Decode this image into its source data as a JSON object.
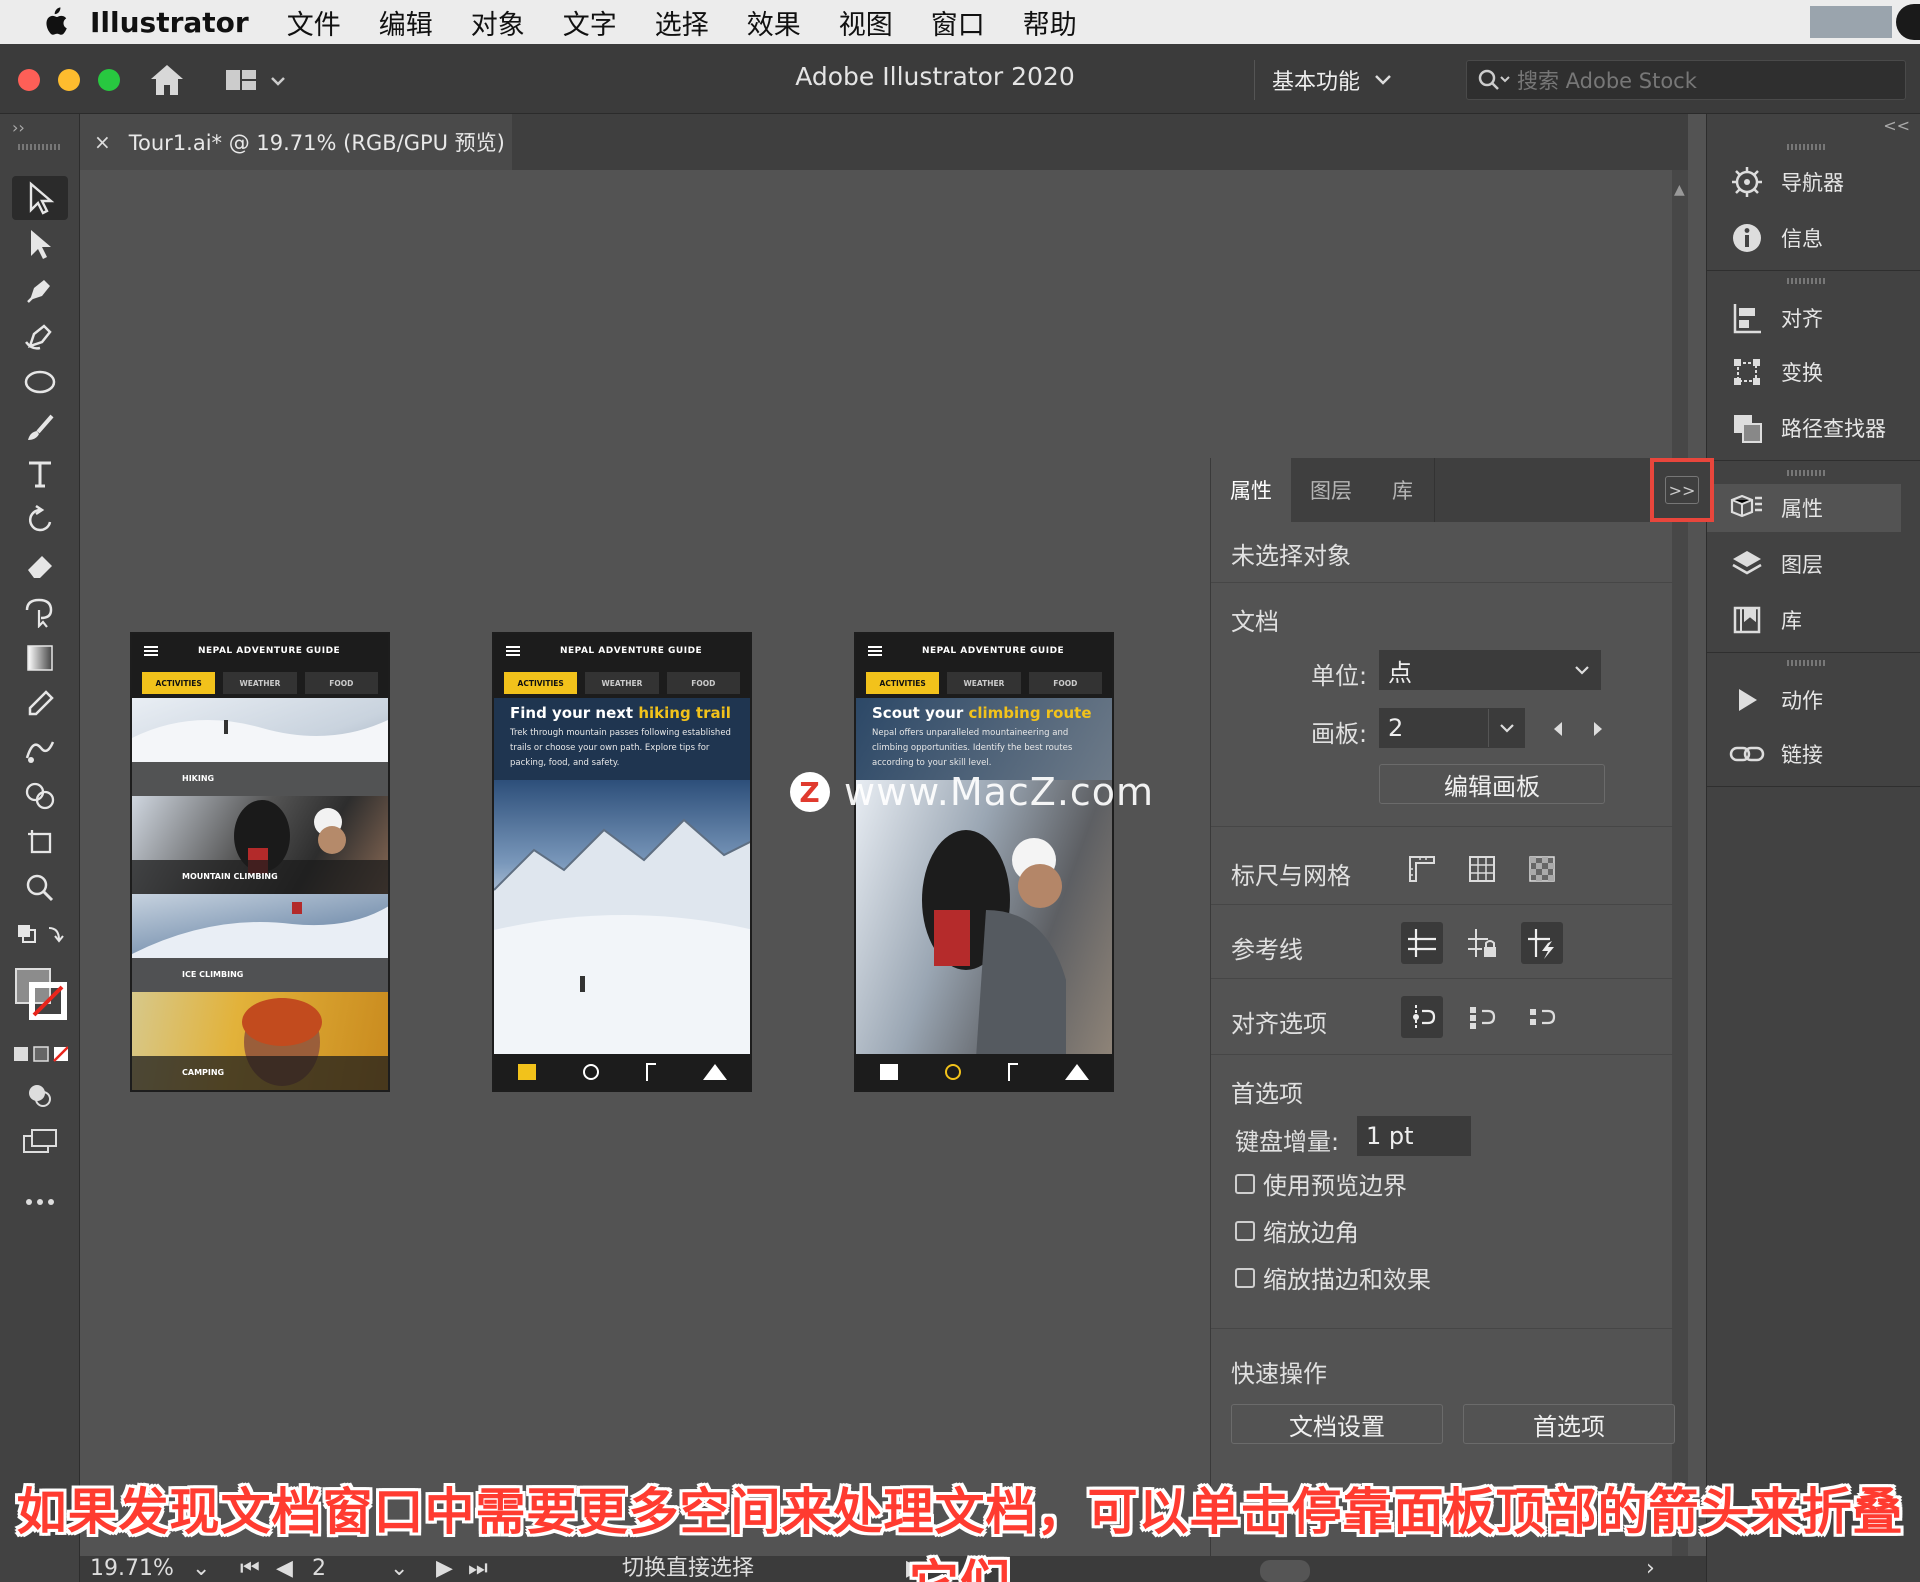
{
  "menubar": {
    "app_name": "Illustrator",
    "items": [
      "文件",
      "编辑",
      "对象",
      "文字",
      "选择",
      "效果",
      "视图",
      "窗口",
      "帮助"
    ]
  },
  "titlebar": {
    "title": "Adobe Illustrator 2020",
    "workspace": "基本功能",
    "search_placeholder": "搜索 Adobe Stock"
  },
  "document_tab": {
    "close": "×",
    "label": "Tour1.ai* @ 19.71% (RGB/GPU 预览)"
  },
  "artboards": [
    {
      "header": "NEPAL ADVENTURE GUIDE",
      "tabs": [
        "ACTIVITIES",
        "WEATHER",
        "FOOD"
      ],
      "rows": [
        "HIKING",
        "MOUNTAIN CLIMBING",
        "ICE CLIMBING",
        "CAMPING"
      ]
    },
    {
      "header": "NEPAL ADVENTURE GUIDE",
      "tabs": [
        "ACTIVITIES",
        "WEATHER",
        "FOOD"
      ],
      "intro_title_pre": "Find your next ",
      "intro_title_em": "hiking trail",
      "intro_text": "Trek through mountain passes following established trails or choose your own path. Explore tips for packing, food, and safety."
    },
    {
      "header": "NEPAL ADVENTURE GUIDE",
      "tabs": [
        "ACTIVITIES",
        "WEATHER",
        "FOOD"
      ],
      "intro_title_pre": "Scout your ",
      "intro_title_em": "climbing route",
      "intro_text": "Nepal offers unparalleled mountaineering and climbing opportunities. Identify the best routes according to your skill level."
    }
  ],
  "watermark": {
    "logo": "Z",
    "text": "www.MacZ.com"
  },
  "properties_panel": {
    "tabs": [
      "属性",
      "图层",
      "库"
    ],
    "collapse_glyph": ">>",
    "no_selection": "未选择对象",
    "document_section": "文档",
    "units_label": "单位:",
    "units_value": "点",
    "artboard_label": "画板:",
    "artboard_value": "2",
    "edit_artboards": "编辑画板",
    "rulers_grids": "标尺与网格",
    "guides": "参考线",
    "snap_options": "对齐选项",
    "preferences_section": "首选项",
    "keyboard_increment_label": "键盘增量:",
    "keyboard_increment_value": "1 pt",
    "checkboxes": [
      "使用预览边界",
      "缩放边角",
      "缩放描边和效果"
    ],
    "quick_actions": "快速操作",
    "doc_setup_button": "文档设置",
    "preferences_button": "首选项"
  },
  "dock": {
    "collapse_glyph": "<<",
    "items": [
      "导航器",
      "信息",
      "对齐",
      "变换",
      "路径查找器",
      "属性",
      "图层",
      "库",
      "动作",
      "链接"
    ]
  },
  "status_bar": {
    "zoom": "19.71%",
    "artboard": "2",
    "tool_hint": "切换直接选择"
  },
  "caption": "如果发现文档窗口中需要更多空间来处理文档，可以单击停靠面板顶部的箭头来折叠它们"
}
